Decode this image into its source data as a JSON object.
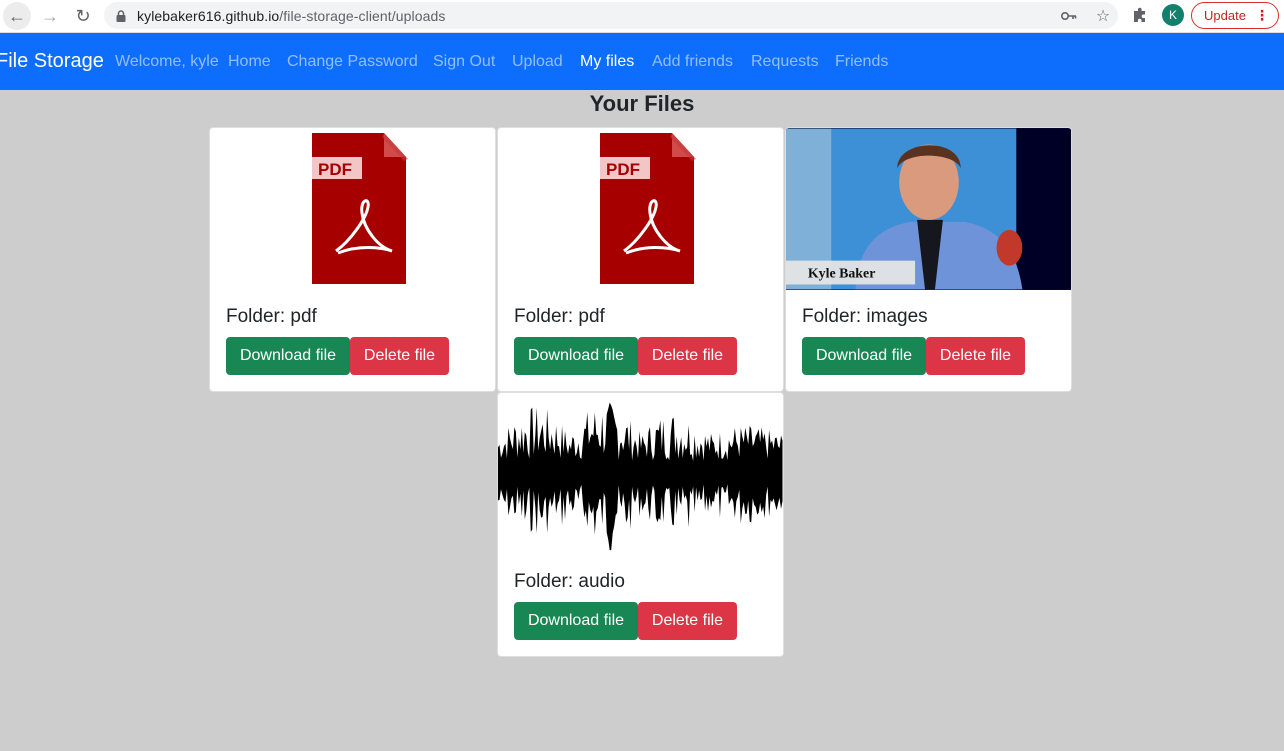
{
  "browser": {
    "url_host": "kylebaker616.github.io",
    "url_path": "/file-storage-client/uploads",
    "profile_initial": "K",
    "update_label": "Update"
  },
  "navbar": {
    "brand": "File Storage",
    "welcome": "Welcome, kyle",
    "links": [
      "Home",
      "Change Password",
      "Sign Out",
      "Upload",
      "My files",
      "Add friends",
      "Requests",
      "Friends"
    ],
    "active": "My files",
    "color": "#0d6efd"
  },
  "page": {
    "title": "Your Files"
  },
  "files": [
    {
      "thumbnail": "pdf-file-icon",
      "thumb_text": "PDF",
      "folder_label": "Folder: pdf",
      "download_label": "Download file",
      "delete_label": "Delete file"
    },
    {
      "thumbnail": "pdf-file-icon",
      "thumb_text": "PDF",
      "folder_label": "Folder: pdf",
      "download_label": "Download file",
      "delete_label": "Delete file"
    },
    {
      "thumbnail": "portrait-photo",
      "thumb_text": "Kyle Baker",
      "folder_label": "Folder: images",
      "download_label": "Download file",
      "delete_label": "Delete file"
    },
    {
      "thumbnail": "audio-waveform",
      "thumb_text": "",
      "folder_label": "Folder: audio",
      "download_label": "Download file",
      "delete_label": "Delete file"
    }
  ],
  "colors": {
    "download": "#198754",
    "delete": "#dc3545",
    "background": "#cdcdcd"
  }
}
